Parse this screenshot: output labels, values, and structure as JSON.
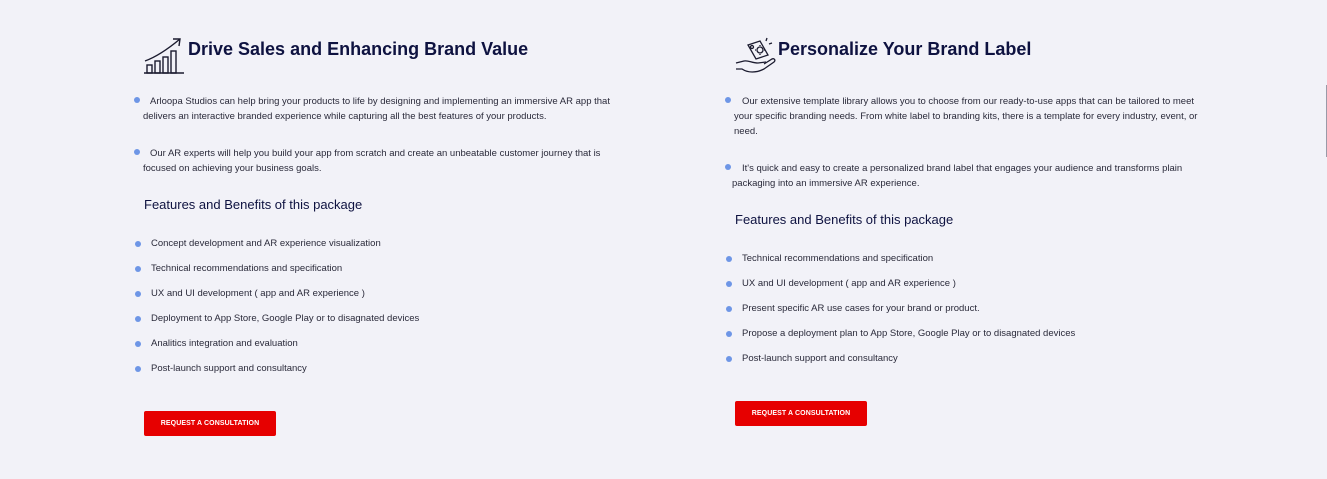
{
  "left": {
    "icon": "growth-chart-icon",
    "title": "Drive Sales and Enhancing Brand Value",
    "paragraphs": [
      "Arloopa Studios can help bring your products to life by designing and implementing an immersive AR app that delivers an interactive branded experience while capturing all the best features of your products.",
      "Our AR experts will help you build your app from scratch and create an unbeatable customer journey that is focused on achieving your business goals."
    ],
    "features_heading": "Features and Benefits of this package",
    "features": [
      "Concept development and AR experience visualization",
      "Technical recommendations and specification",
      "UX and UI development ( app and AR experience )",
      "Deployment to App Store, Google Play or to disagnated devices",
      "Analitics integration and evaluation",
      "Post-launch support and consultancy"
    ],
    "cta_label": "REQUEST A CONSULTATION"
  },
  "right": {
    "icon": "hand-label-icon",
    "title": "Personalize Your Brand Label",
    "paragraphs": [
      "Our extensive template library allows you to choose from our ready-to-use apps that can be tailored to meet your specific branding needs. From white label to branding kits, there is a template for every industry, event, or need.",
      "It's quick and easy to create a personalized brand label that engages your audience and transforms plain packaging into an immersive AR experience."
    ],
    "features_heading": "Features and Benefits of this package",
    "features": [
      "Technical recommendations and specification",
      "UX and UI development ( app and AR experience )",
      "Present specific AR use cases for your brand or product.",
      "Propose a deployment plan to App Store, Google Play or to disagnated devices",
      "Post-launch support and consultancy"
    ],
    "cta_label": "REQUEST A CONSULTATION"
  },
  "colors": {
    "background": "#f2f2f8",
    "heading": "#0e1240",
    "bullet": "#6e96e6",
    "cta": "#e60000"
  }
}
